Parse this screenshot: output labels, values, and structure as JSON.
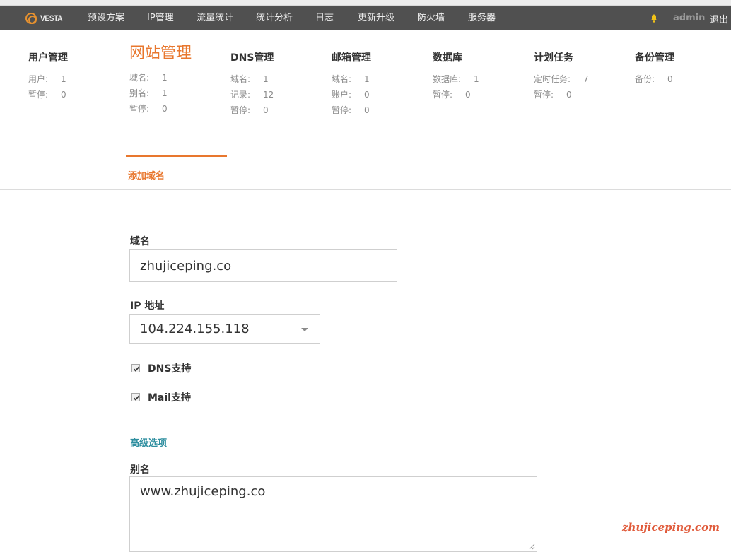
{
  "app": {
    "logo_text": "VESTA",
    "accent_color": "#e8772e",
    "navbar_color": "#505050"
  },
  "navbar": {
    "items": [
      {
        "label": "预设方案"
      },
      {
        "label": "IP管理"
      },
      {
        "label": "流量统计"
      },
      {
        "label": "统计分析"
      },
      {
        "label": "日志"
      },
      {
        "label": "更新升级"
      },
      {
        "label": "防火墙"
      },
      {
        "label": "服务器"
      }
    ],
    "notification_icon": "bell-icon",
    "username": "admin",
    "logout_label": "退出"
  },
  "stats": [
    {
      "title": "用户管理",
      "rows": [
        {
          "label": "用户:",
          "value": "1"
        },
        {
          "label": "暂停:",
          "value": "0"
        }
      ]
    },
    {
      "title": "网站管理",
      "active": true,
      "rows": [
        {
          "label": "域名:",
          "value": "1"
        },
        {
          "label": "别名:",
          "value": "1"
        },
        {
          "label": "暂停:",
          "value": "0"
        }
      ]
    },
    {
      "title": "DNS管理",
      "rows": [
        {
          "label": "域名:",
          "value": "1"
        },
        {
          "label": "记录:",
          "value": "12"
        },
        {
          "label": "暂停:",
          "value": "0"
        }
      ]
    },
    {
      "title": "邮箱管理",
      "rows": [
        {
          "label": "域名:",
          "value": "1"
        },
        {
          "label": "账户:",
          "value": "0"
        },
        {
          "label": "暂停:",
          "value": "0"
        }
      ]
    },
    {
      "title": "数据库",
      "rows": [
        {
          "label": "数据库:",
          "value": "1"
        },
        {
          "label": "暂停:",
          "value": "0"
        }
      ]
    },
    {
      "title": "计划任务",
      "rows": [
        {
          "label": "定时任务:",
          "value": "7"
        },
        {
          "label": "暂停:",
          "value": "0"
        }
      ]
    },
    {
      "title": "备份管理",
      "rows": [
        {
          "label": "备份:",
          "value": "0"
        }
      ]
    }
  ],
  "subnav": {
    "add_domain_label": "添加域名"
  },
  "form": {
    "domain_label": "域名",
    "domain_value": "zhujiceping.co",
    "ip_label": "IP 地址",
    "ip_value": "104.224.155.118",
    "dns_support_label": "DNS支持",
    "dns_support_checked": true,
    "mail_support_label": "Mail支持",
    "mail_support_checked": true,
    "advanced_label": "高级选项",
    "alias_label": "别名",
    "alias_value": "www.zhujiceping.co"
  },
  "watermark": "zhujiceping.com"
}
